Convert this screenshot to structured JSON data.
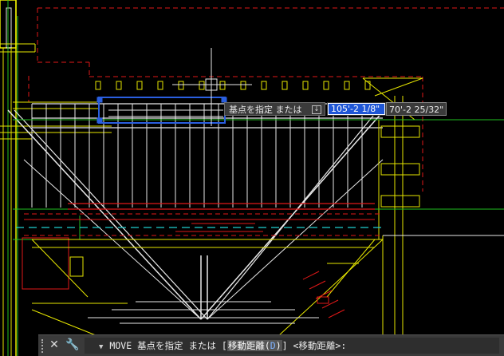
{
  "drawing": {
    "colors": {
      "yellow": "#e6e600",
      "white": "#e8e8e8",
      "red": "#e01818",
      "cyan": "#20d0d0",
      "green": "#20c020",
      "selection": "#2a5fe0"
    }
  },
  "dynamic_input": {
    "prompt": "基点を指定 または",
    "dropdown_icon": "chevron-down-icon",
    "x_value": "105'-2 1/8\"",
    "y_value": "70'-2 25/32\""
  },
  "command_line": {
    "close_icon": "close-icon",
    "settings_icon": "wrench-icon",
    "command": "MOVE",
    "prompt_pre": "基点を指定 または [",
    "option_label": "移動距離",
    "option_key_open": "(",
    "option_key": "D",
    "option_key_close": ")",
    "prompt_post": "] <移動距離>:"
  }
}
